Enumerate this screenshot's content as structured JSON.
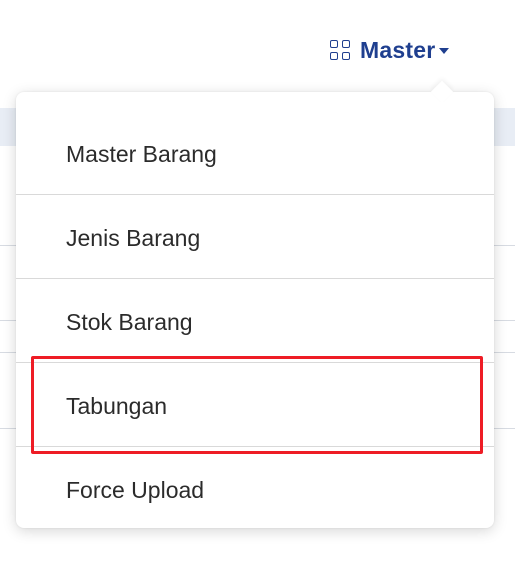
{
  "nav": {
    "label": "Master",
    "icon": "grid-icon",
    "color": "#1f3f8f"
  },
  "menu": {
    "items": [
      {
        "label": "Master Barang"
      },
      {
        "label": "Jenis Barang"
      },
      {
        "label": "Stok Barang"
      },
      {
        "label": "Tabungan",
        "highlighted": true
      },
      {
        "label": "Force Upload"
      }
    ]
  },
  "highlight": {
    "color": "#ee1c25",
    "target": "Tabungan"
  }
}
